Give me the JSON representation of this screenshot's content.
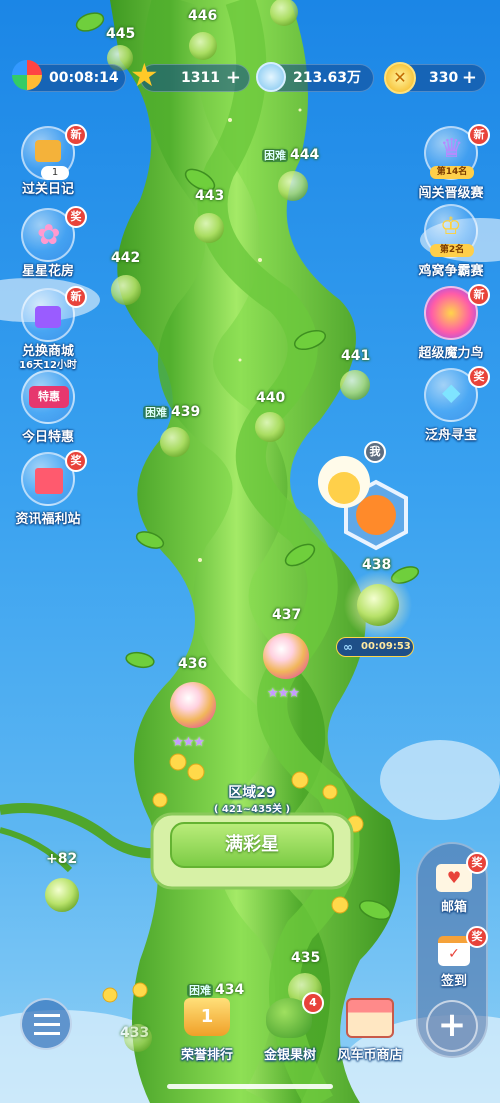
{
  "topbar": {
    "timer": "00:08:14",
    "stars": "1311",
    "coins": "213.63万",
    "gold": "330",
    "plus": "+"
  },
  "left_menu": [
    {
      "label": "过关日记",
      "badge": "新",
      "sub": "1"
    },
    {
      "label": "星星花房",
      "badge": "奖"
    },
    {
      "label": "兑换商城",
      "badge": "新",
      "sub": "16天12小时"
    },
    {
      "label": "今日特惠",
      "inner": "特惠"
    },
    {
      "label": "资讯福利站",
      "badge": "奖"
    }
  ],
  "right_menu": [
    {
      "label": "闯关晋级赛",
      "badge": "新",
      "rank": "第14名"
    },
    {
      "label": "鸡窝争霸赛",
      "rank": "第2名"
    },
    {
      "label": "超级魔力鸟",
      "badge": "新"
    },
    {
      "label": "泛舟寻宝",
      "badge": "奖"
    }
  ],
  "levels": {
    "l433": "433",
    "l434": "434",
    "l435": "435",
    "l436": "436",
    "l437": "437",
    "l438": "438",
    "l439": "439",
    "l440": "440",
    "l441": "441",
    "l442": "442",
    "l443": "443",
    "l444": "444",
    "l445": "445",
    "l446": "446",
    "hard": "困难",
    "bonus": "+82"
  },
  "player": {
    "me": "我",
    "timer": "00:09:53"
  },
  "region": {
    "title": "区域29",
    "range": "( 421~435关 )",
    "button": "满彩星"
  },
  "right_dock": {
    "mail": "邮箱",
    "mail_badge": "奖",
    "signin": "签到",
    "signin_badge": "奖",
    "plus": "+"
  },
  "bottom": {
    "rank": "荣誉排行",
    "tree": "金银果树",
    "tree_badge": "4",
    "shop": "风车币商店"
  },
  "colors": {
    "sky": "#2a94ea",
    "vine": "#5cc23a",
    "badge": "#e8433a",
    "button": "#8fd85a"
  }
}
